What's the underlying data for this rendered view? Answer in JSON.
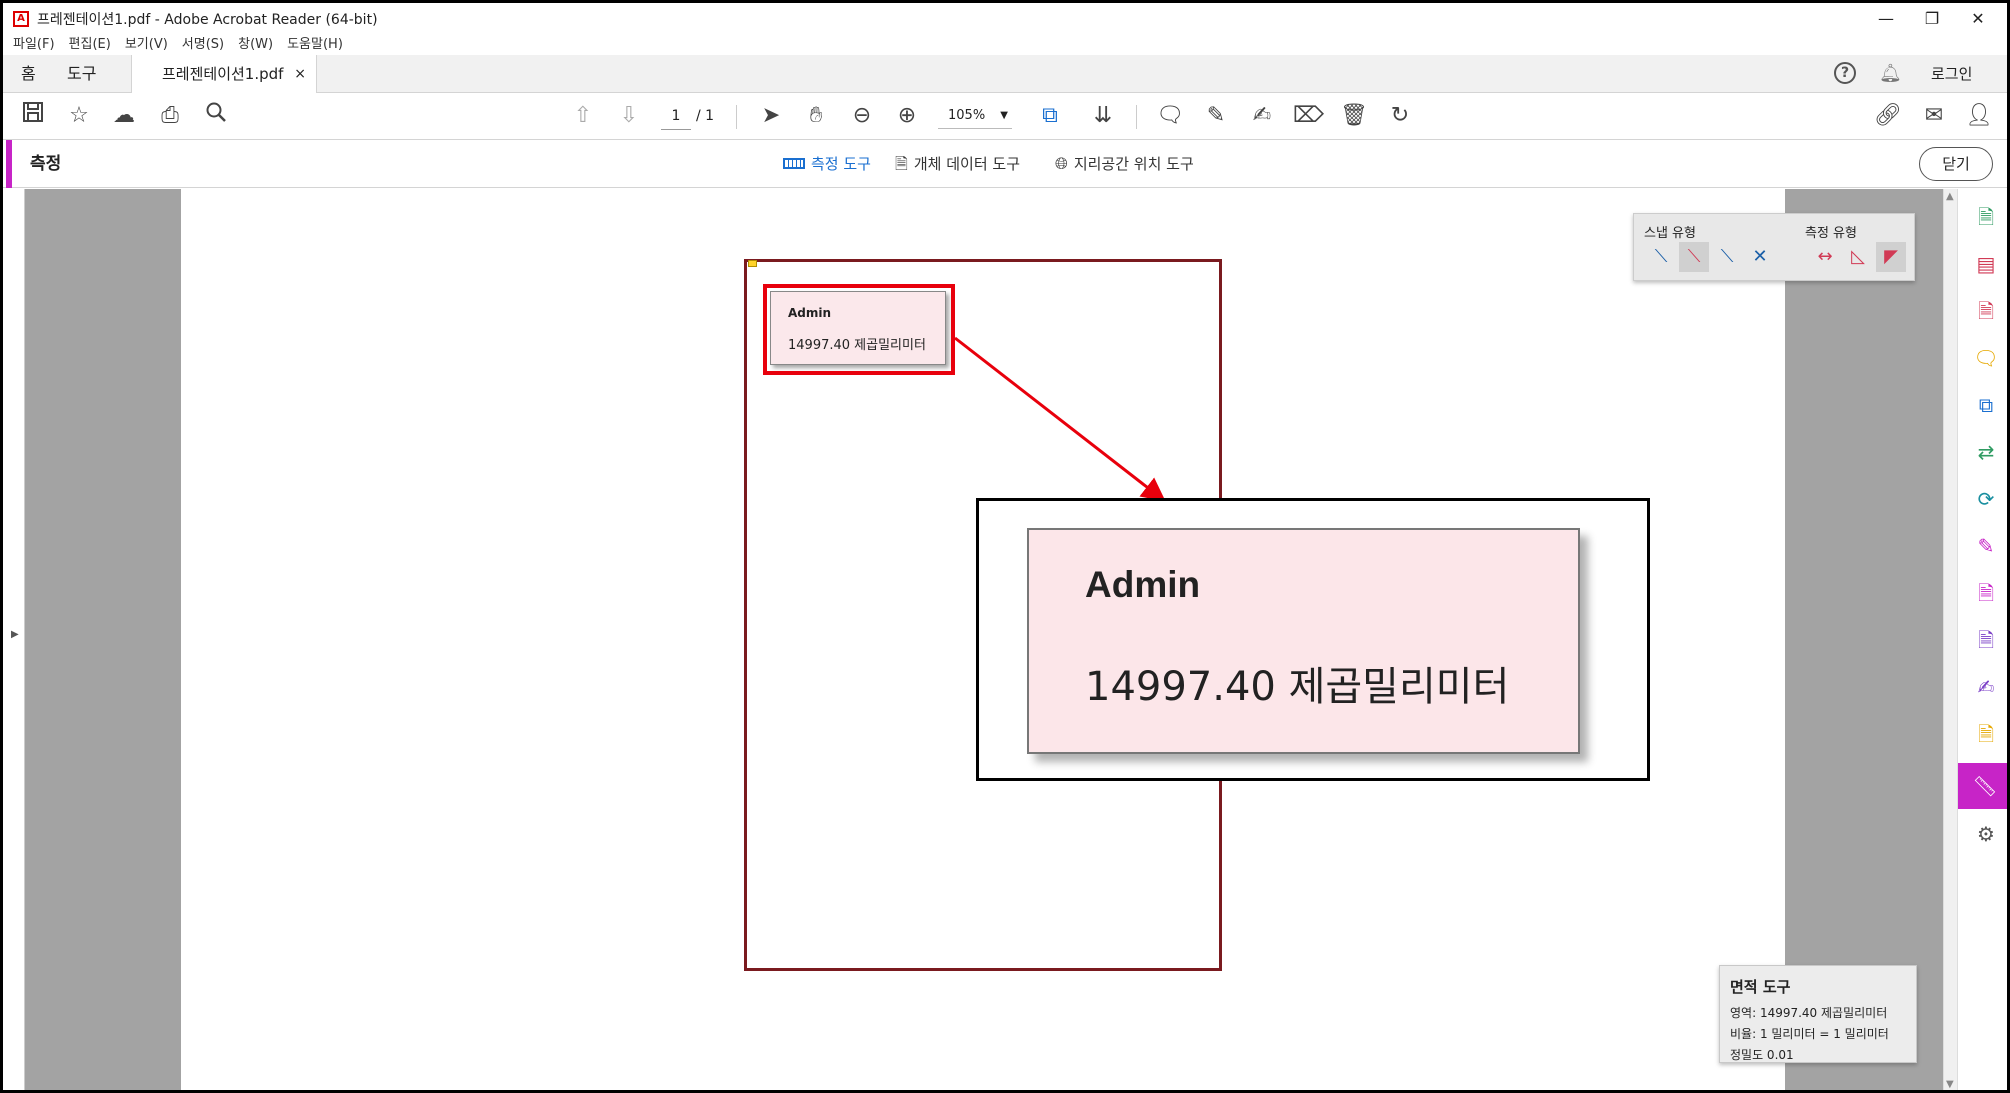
{
  "window": {
    "title": "프레젠테이션1.pdf - Adobe Acrobat Reader (64-bit)",
    "minimize": "—",
    "restore": "❐",
    "close": "✕"
  },
  "menu": [
    "파일(F)",
    "편집(E)",
    "보기(V)",
    "서명(S)",
    "창(W)",
    "도움말(H)"
  ],
  "tabs": {
    "home": "홈",
    "tools": "도구",
    "document": "프레젠테이션1.pdf",
    "document_close": "×",
    "login": "로그인"
  },
  "toolbar": {
    "page_current": "1",
    "page_total": "/ 1",
    "zoom": "105%"
  },
  "measure_bar": {
    "title": "측정",
    "tools": [
      "측정 도구",
      "개체 데이터 도구",
      "지리공간 위치 도구"
    ],
    "close_label": "닫기"
  },
  "annotation": {
    "author": "Admin",
    "value": "14997.40 제곱밀리미터"
  },
  "snap_panel": {
    "snap_label": "스냅 유형",
    "measure_label": "측정 유형"
  },
  "info_panel": {
    "title": "면적 도구",
    "area": "영역: 14997.40 제곱밀리미터",
    "ratio": "비율:    1 밀리미터 = 1 밀리미터",
    "precision": "정밀도 0.01"
  },
  "colors": {
    "accent": "#c724c7",
    "highlight": "#e8000c",
    "link": "#1a6fd0"
  }
}
